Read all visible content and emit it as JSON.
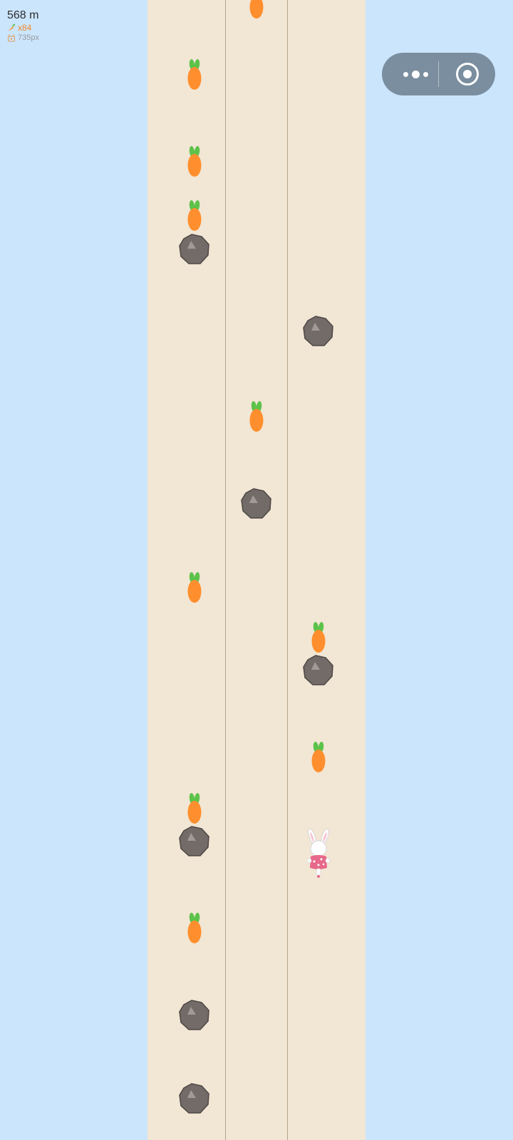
{
  "hud": {
    "distance": "568 m",
    "carrots": "x84",
    "speed": "735px"
  },
  "capsule": {
    "more_icon": "more-dots-icon",
    "close_icon": "target-close-icon"
  },
  "colors": {
    "background": "#cbe5fd",
    "road": "#f2e6d4",
    "lane_line": "#b5a48c",
    "carrot": "#ff8f2e",
    "carrot_leaf": "#5cc24a",
    "rock": "#726b68",
    "bunny_shirt": "#e7698a",
    "capsule": "#7a8ea0"
  },
  "game": {
    "lanes": 3,
    "player_lane": 3,
    "objects": [
      {
        "type": "carrot",
        "lane": 2
      },
      {
        "type": "carrot",
        "lane": 1
      },
      {
        "type": "carrot",
        "lane": 1
      },
      {
        "type": "carrot",
        "lane": 1
      },
      {
        "type": "rock",
        "lane": 1
      },
      {
        "type": "rock",
        "lane": 3
      },
      {
        "type": "carrot",
        "lane": 2
      },
      {
        "type": "rock",
        "lane": 2
      },
      {
        "type": "carrot",
        "lane": 1
      },
      {
        "type": "carrot",
        "lane": 3
      },
      {
        "type": "rock",
        "lane": 3
      },
      {
        "type": "carrot",
        "lane": 3
      },
      {
        "type": "carrot",
        "lane": 1
      },
      {
        "type": "rock",
        "lane": 1
      },
      {
        "type": "carrot",
        "lane": 1
      },
      {
        "type": "rock",
        "lane": 1
      },
      {
        "type": "rock",
        "lane": 1
      }
    ]
  }
}
